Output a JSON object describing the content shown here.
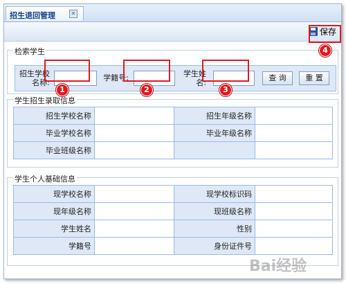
{
  "tab": {
    "title": "招生退回管理",
    "close_symbol": "✕"
  },
  "toolbar": {
    "save_label": "保存"
  },
  "search": {
    "legend": "检索学生",
    "school_label": "招生学校名称:",
    "school_value": "",
    "student_no_label": "学籍号:",
    "student_no_value": "",
    "student_name_label": "学生姓名:",
    "student_name_value": "",
    "query_button": "查 询",
    "reset_button": "重 置"
  },
  "enrollment": {
    "legend": "学生招生录取信息",
    "rows": [
      {
        "k1": "招生学校名称",
        "v1": "",
        "k2": "招生年级名称",
        "v2": ""
      },
      {
        "k1": "毕业学校名称",
        "v1": "",
        "k2": "毕业年级名称",
        "v2": ""
      },
      {
        "k1": "毕业班级名称",
        "v1": "",
        "k2": "",
        "v2": ""
      }
    ]
  },
  "personal": {
    "legend": "学生个人基础信息",
    "rows": [
      {
        "k1": "现学校名称",
        "v1": "",
        "k2": "现学校标识码",
        "v2": ""
      },
      {
        "k1": "现年级名称",
        "v1": "",
        "k2": "现班级名称",
        "v2": ""
      },
      {
        "k1": "学生姓名",
        "v1": "",
        "k2": "性别",
        "v2": ""
      },
      {
        "k1": "学籍号",
        "v1": "",
        "k2": "身份证件号",
        "v2": ""
      }
    ]
  },
  "callouts": [
    "1",
    "2",
    "3",
    "4"
  ],
  "watermark": "Bai经验",
  "colors": {
    "callout_red": "#e2191f",
    "header_blue": "#15428b",
    "panel_bg": "#dfe8f6"
  }
}
